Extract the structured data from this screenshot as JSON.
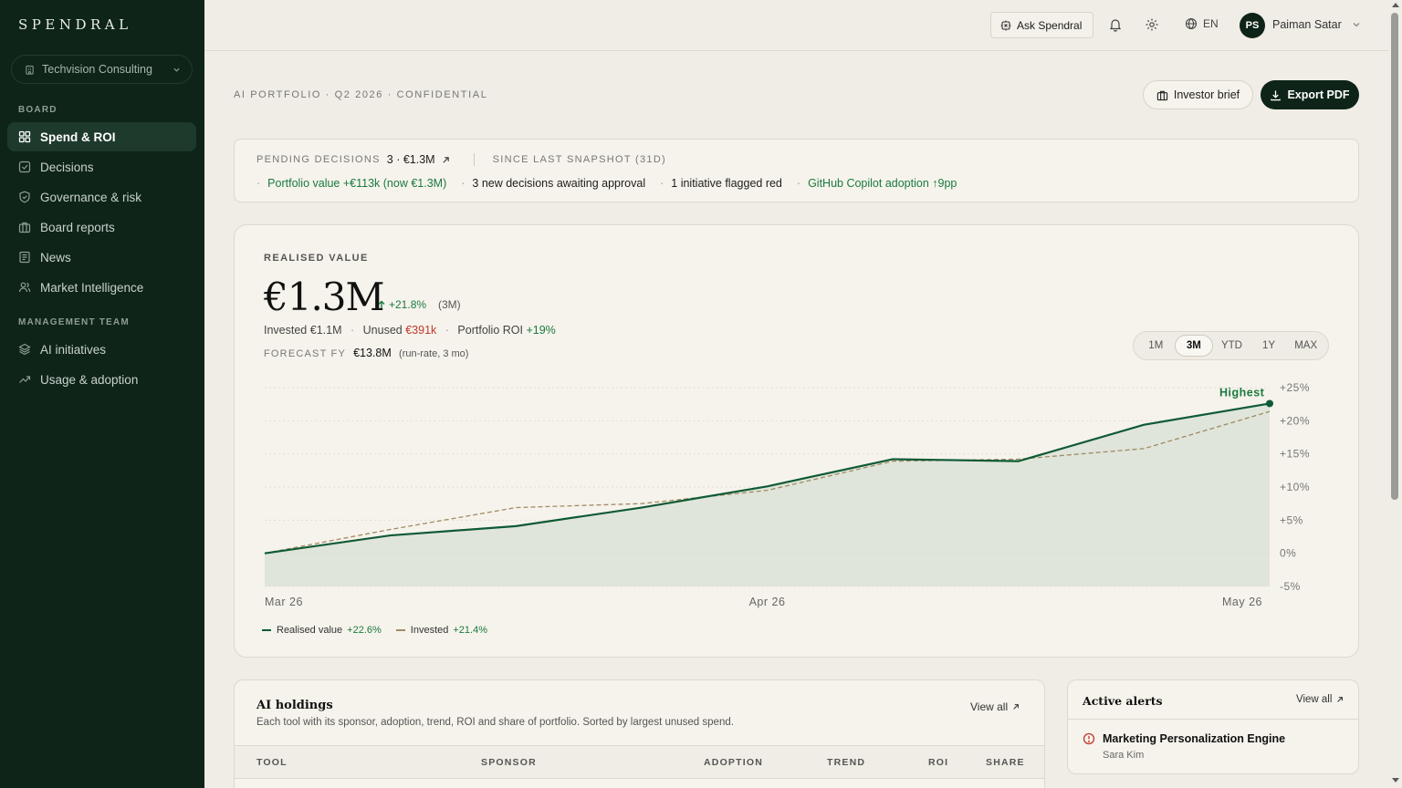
{
  "brand": "SPENDRAL",
  "org": {
    "name": "Techvision Consulting"
  },
  "sidebar": {
    "sections": [
      {
        "label": "BOARD",
        "items": [
          {
            "label": "Spend & ROI",
            "icon": "grid-icon",
            "active": true
          },
          {
            "label": "Decisions",
            "icon": "check-square-icon"
          },
          {
            "label": "Governance & risk",
            "icon": "shield-icon"
          },
          {
            "label": "Board reports",
            "icon": "briefcase-icon"
          },
          {
            "label": "News",
            "icon": "newspaper-icon"
          },
          {
            "label": "Market Intelligence",
            "icon": "users-icon"
          }
        ]
      },
      {
        "label": "MANAGEMENT TEAM",
        "items": [
          {
            "label": "AI initiatives",
            "icon": "layers-icon"
          },
          {
            "label": "Usage & adoption",
            "icon": "trend-icon"
          }
        ]
      }
    ]
  },
  "topbar": {
    "ask_label": "Ask Spendral",
    "lang": "EN",
    "user": {
      "initials": "PS",
      "name": "Paiman Satar"
    }
  },
  "header": {
    "eyebrow": "AI PORTFOLIO · Q2 2026 · CONFIDENTIAL",
    "investor_brief": "Investor brief",
    "export_pdf": "Export PDF"
  },
  "pending": {
    "label": "PENDING DECISIONS",
    "value": "3 · €1.3M",
    "since_label": "SINCE LAST SNAPSHOT (31D)",
    "items": [
      {
        "text": "Portfolio value +€113k (now €1.3M)",
        "tone": "green"
      },
      {
        "text": "3 new decisions awaiting approval",
        "tone": "neutral"
      },
      {
        "text": "1 initiative flagged red",
        "tone": "neutral"
      },
      {
        "text": "GitHub Copilot adoption ↑9pp",
        "tone": "green"
      }
    ]
  },
  "realised": {
    "label": "REALISED VALUE",
    "value": "€1.3M",
    "change": "+21.8%",
    "period": "(3M)",
    "invested_label": "Invested",
    "invested": "€1.1M",
    "unused_label": "Unused",
    "unused": "€391k",
    "roi_label": "Portfolio ROI",
    "roi": "+19%",
    "forecast_label": "FORECAST FY",
    "forecast_value": "€13.8M",
    "forecast_note": "(run-rate, 3 mo)",
    "ranges": [
      "1M",
      "3M",
      "YTD",
      "1Y",
      "MAX"
    ],
    "active_range": "3M"
  },
  "colors": {
    "realised": "#0f5a35",
    "invested": "#a08a62",
    "area": "#dde3d8",
    "green": "#1a7a3e",
    "red": "#c0392b"
  },
  "chart_data": {
    "type": "line",
    "x_tick_labels": [
      "Mar 26",
      "Apr 26",
      "May 26"
    ],
    "y_ticks": [
      25,
      20,
      15,
      10,
      5,
      0,
      -5
    ],
    "y_tick_labels": [
      "+25%",
      "+20%",
      "+15%",
      "+10%",
      "+5%",
      "0%",
      "-5%"
    ],
    "ylim": [
      -5,
      25
    ],
    "y_unit": "%",
    "grid": true,
    "annotation": {
      "label": "Highest",
      "series": "Realised value"
    },
    "series": [
      {
        "name": "Realised value",
        "change": "+22.6%",
        "style": "solid",
        "values": [
          0,
          2.7,
          4.1,
          6.9,
          10.1,
          14.2,
          13.9,
          19.4,
          22.6
        ]
      },
      {
        "name": "Invested",
        "change": "+21.4%",
        "style": "dashed",
        "values": [
          0,
          3.6,
          6.9,
          7.5,
          9.5,
          13.9,
          14.2,
          15.8,
          21.4
        ]
      }
    ]
  },
  "holdings": {
    "title": "AI holdings",
    "subtitle": "Each tool with its sponsor, adoption, trend, ROI and share of portfolio. Sorted by largest unused spend.",
    "view_all": "View all",
    "columns": [
      "TOOL",
      "SPONSOR",
      "ADOPTION",
      "TREND",
      "ROI",
      "SHARE"
    ]
  },
  "alerts": {
    "title": "Active alerts",
    "view_all": "View all",
    "items": [
      {
        "name": "Marketing Personalization Engine",
        "owner": "Sara Kim"
      }
    ]
  }
}
